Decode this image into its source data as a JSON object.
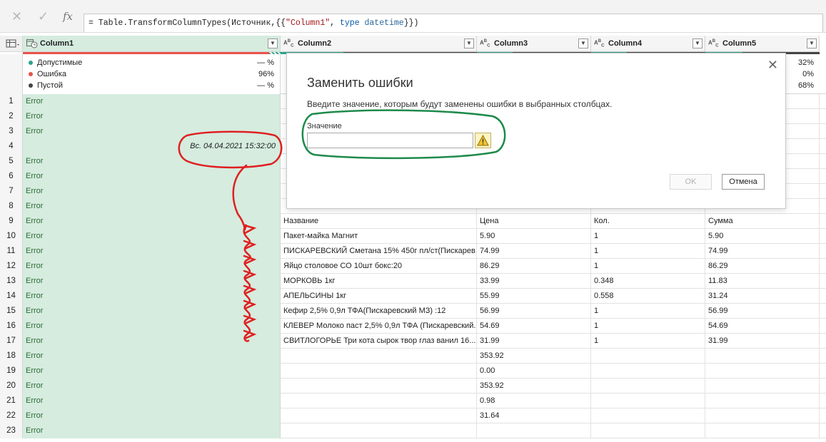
{
  "formula_bar": {
    "cancel_symbol": "✕",
    "commit_symbol": "✓",
    "fx_label": "fx",
    "formula_prefix": "= Table.TransformColumnTypes(Источник,{{",
    "formula_string": "\"Column1\"",
    "formula_mid": ", ",
    "formula_keyword": "type",
    "formula_space": " ",
    "formula_type": "datetime",
    "formula_suffix": "}})"
  },
  "columns": [
    {
      "name": "Column1",
      "type_glyph": "datetime"
    },
    {
      "name": "Column2",
      "type_glyph": "ABC"
    },
    {
      "name": "Column3",
      "type_glyph": "ABC"
    },
    {
      "name": "Column4",
      "type_glyph": "ABC"
    },
    {
      "name": "Column5",
      "type_glyph": "ABC"
    }
  ],
  "column_quality": {
    "labels": {
      "valid": "Допустимые",
      "error": "Ошибка",
      "empty": "Пустой"
    },
    "column1": {
      "valid": "— %",
      "error": "96%",
      "empty": "— %"
    },
    "column5": {
      "valid": "32%",
      "error": "0%",
      "empty": "68%"
    },
    "colors": {
      "valid": "#2aa58a",
      "error": "#e8524a",
      "empty": "#444444"
    }
  },
  "rows": [
    {
      "n": "1",
      "c1": "Error",
      "c2": "",
      "c3": "",
      "c4": "",
      "c5": ""
    },
    {
      "n": "2",
      "c1": "Error",
      "c2": "",
      "c3": "",
      "c4": "",
      "c5": ""
    },
    {
      "n": "3",
      "c1": "Error",
      "c2": "",
      "c3": "",
      "c4": "",
      "c5": ""
    },
    {
      "n": "4",
      "c1": "Вс. 04.04.2021 15:32:00",
      "c2": "",
      "c3": "",
      "c4": "",
      "c5": ""
    },
    {
      "n": "5",
      "c1": "Error",
      "c2": "",
      "c3": "",
      "c4": "",
      "c5": ""
    },
    {
      "n": "6",
      "c1": "Error",
      "c2": "",
      "c3": "",
      "c4": "",
      "c5": ""
    },
    {
      "n": "7",
      "c1": "Error",
      "c2": "",
      "c3": "",
      "c4": "",
      "c5": ""
    },
    {
      "n": "8",
      "c1": "Error",
      "c2": "",
      "c3": "",
      "c4": "",
      "c5": ""
    },
    {
      "n": "9",
      "c1": "Error",
      "c2": "Название",
      "c3": "Цена",
      "c4": "Кол.",
      "c5": "Сумма"
    },
    {
      "n": "10",
      "c1": "Error",
      "c2": "Пакет-майка Магнит",
      "c3": "5.90",
      "c4": "1",
      "c5": "5.90"
    },
    {
      "n": "11",
      "c1": "Error",
      "c2": "ПИСКАРЕВСКИЙ Сметана 15% 450г пл/ст(Пискарев...",
      "c3": "74.99",
      "c4": "1",
      "c5": "74.99"
    },
    {
      "n": "12",
      "c1": "Error",
      "c2": "Яйцо столовое СО 10шт бокс:20",
      "c3": "86.29",
      "c4": "1",
      "c5": "86.29"
    },
    {
      "n": "13",
      "c1": "Error",
      "c2": "МОРКОВЬ 1кг",
      "c3": "33.99",
      "c4": "0.348",
      "c5": "11.83"
    },
    {
      "n": "14",
      "c1": "Error",
      "c2": "АПЕЛЬСИНЫ 1кг",
      "c3": "55.99",
      "c4": "0.558",
      "c5": "31.24"
    },
    {
      "n": "15",
      "c1": "Error",
      "c2": "Кефир 2,5% 0,9л ТФА(Пискаревский МЗ) :12",
      "c3": "56.99",
      "c4": "1",
      "c5": "56.99"
    },
    {
      "n": "16",
      "c1": "Error",
      "c2": "КЛЕВЕР Молоко паст 2,5% 0,9л ТФА (Пискаревский...",
      "c3": "54.69",
      "c4": "1",
      "c5": "54.69"
    },
    {
      "n": "17",
      "c1": "Error",
      "c2": "СВИТЛОГОРЬЕ Три кота сырок твор глаз ванил 16...",
      "c3": "31.99",
      "c4": "1",
      "c5": "31.99"
    },
    {
      "n": "18",
      "c1": "Error",
      "c2": "",
      "c3": "353.92",
      "c4": "",
      "c5": ""
    },
    {
      "n": "19",
      "c1": "Error",
      "c2": "",
      "c3": "0.00",
      "c4": "",
      "c5": ""
    },
    {
      "n": "20",
      "c1": "Error",
      "c2": "",
      "c3": "353.92",
      "c4": "",
      "c5": ""
    },
    {
      "n": "21",
      "c1": "Error",
      "c2": "",
      "c3": "0.98",
      "c4": "",
      "c5": ""
    },
    {
      "n": "22",
      "c1": "Error",
      "c2": "",
      "c3": "31.64",
      "c4": "",
      "c5": ""
    },
    {
      "n": "23",
      "c1": "Error",
      "c2": "",
      "c3": "",
      "c4": "",
      "c5": ""
    }
  ],
  "dialog": {
    "title": "Заменить ошибки",
    "description": "Введите значение, которым будут заменены ошибки в выбранных столбцах.",
    "value_label": "Значение",
    "value": "",
    "ok_label": "OK",
    "cancel_label": "Отмена",
    "close_symbol": "✕"
  },
  "annotation_color": "#e02020",
  "highlight_color": "#1e8a4a"
}
